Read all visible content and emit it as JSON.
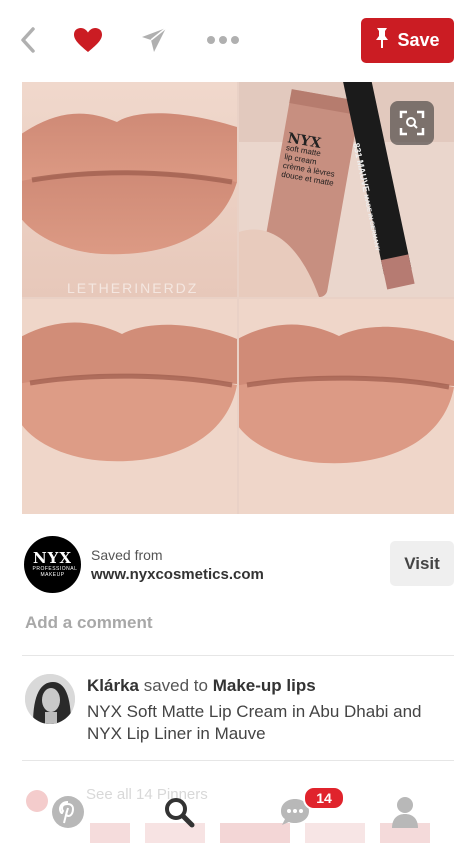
{
  "colors": {
    "brand_red": "#cb1c23",
    "badge_red": "#e0232c",
    "icon_gray": "#b0b0b0",
    "heart_red": "#cb1c23"
  },
  "topbar": {
    "icons": [
      "back-chevron-icon",
      "heart-icon",
      "send-icon",
      "more-dots-icon"
    ],
    "save_label": "Save"
  },
  "pin": {
    "watermark": "LETHERINERDZ",
    "product_text": {
      "brand": "NYX",
      "tube_line1": "soft matte",
      "tube_line2": "lip cream",
      "tube_line3": "crème à lèvres",
      "tube_line4": "douce et matte",
      "pencil": "831 MAUVE",
      "pencil_sub": "MADE IN GERMANY"
    }
  },
  "source": {
    "logo_main": "NYX",
    "logo_sub": "PROFESSIONAL MAKEUP",
    "saved_from": "Saved from",
    "url": "www.nyxcosmetics.com",
    "visit_label": "Visit"
  },
  "comment": {
    "placeholder": "Add a comment"
  },
  "saver": {
    "name": "Klárka",
    "action": "saved to",
    "board": "Make-up lips",
    "description": "NYX Soft Matte Lip Cream in Abu Dhabi and NYX Lip Liner in Mauve"
  },
  "bottom_nav": {
    "ghost_text": "See all 14 Pinners",
    "items": [
      "pinterest-logo-icon",
      "search-icon",
      "messages-icon",
      "profile-icon"
    ],
    "badge_count": "14"
  }
}
